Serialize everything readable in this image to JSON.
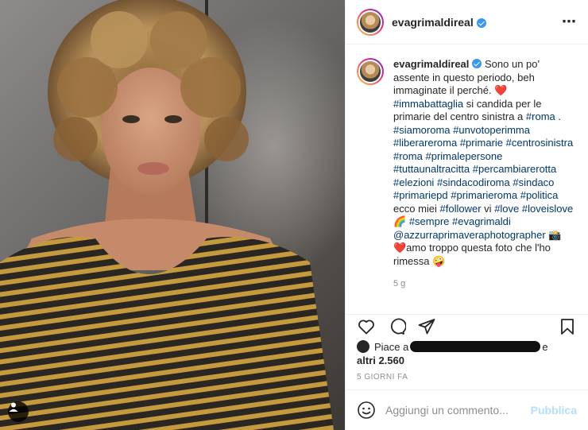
{
  "post": {
    "username": "evagrimaldireal",
    "caption": {
      "segments": [
        {
          "type": "text",
          "value": "Sono un po' assente in questo periodo, beh immaginate il perché. ❤️ "
        },
        {
          "type": "tag",
          "value": "#immabattaglia"
        },
        {
          "type": "text",
          "value": " si candida per le primarie del centro sinistra a "
        },
        {
          "type": "tag",
          "value": "#roma"
        },
        {
          "type": "text",
          "value": " . "
        },
        {
          "type": "tag",
          "value": "#siamoroma"
        },
        {
          "type": "text",
          "value": " "
        },
        {
          "type": "tag",
          "value": "#unvotoperimma"
        },
        {
          "type": "text",
          "value": " "
        },
        {
          "type": "tag",
          "value": "#liberareroma"
        },
        {
          "type": "text",
          "value": " "
        },
        {
          "type": "tag",
          "value": "#primarie"
        },
        {
          "type": "text",
          "value": " "
        },
        {
          "type": "tag",
          "value": "#centrosinistra"
        },
        {
          "type": "text",
          "value": " "
        },
        {
          "type": "tag",
          "value": "#roma"
        },
        {
          "type": "text",
          "value": " "
        },
        {
          "type": "tag",
          "value": "#primalepersone"
        },
        {
          "type": "text",
          "value": " "
        },
        {
          "type": "tag",
          "value": "#tuttaunaltracitta"
        },
        {
          "type": "text",
          "value": " "
        },
        {
          "type": "tag",
          "value": "#percambiarerotta"
        },
        {
          "type": "text",
          "value": " "
        },
        {
          "type": "tag",
          "value": "#elezioni"
        },
        {
          "type": "text",
          "value": " "
        },
        {
          "type": "tag",
          "value": "#sindacodiroma"
        },
        {
          "type": "text",
          "value": " "
        },
        {
          "type": "tag",
          "value": "#sindaco"
        },
        {
          "type": "text",
          "value": " "
        },
        {
          "type": "tag",
          "value": "#primariepd"
        },
        {
          "type": "text",
          "value": " "
        },
        {
          "type": "tag",
          "value": "#primarieroma"
        },
        {
          "type": "text",
          "value": " "
        },
        {
          "type": "tag",
          "value": "#politica"
        },
        {
          "type": "text",
          "value": " ecco miei "
        },
        {
          "type": "tag",
          "value": "#follower"
        },
        {
          "type": "text",
          "value": " vi "
        },
        {
          "type": "tag",
          "value": "#love"
        },
        {
          "type": "text",
          "value": " "
        },
        {
          "type": "tag",
          "value": "#loveislove"
        },
        {
          "type": "text",
          "value": "🌈 "
        },
        {
          "type": "tag",
          "value": "#sempre"
        },
        {
          "type": "text",
          "value": " "
        },
        {
          "type": "tag",
          "value": "#evagrimaldi"
        },
        {
          "type": "text",
          "value": " "
        },
        {
          "type": "tag",
          "value": "@azzurraprimaveraphotographer"
        },
        {
          "type": "text",
          "value": " 📸 ❤️amo troppo questa foto che l'ho rimessa 🤪"
        }
      ]
    },
    "time_ago": "5 g",
    "likes": {
      "prefix": "Piace a",
      "suffix": "e",
      "others": "altri 2.560"
    },
    "date": "5 GIORNI FA",
    "comment": {
      "placeholder": "Aggiungi un commento...",
      "publish_label": "Pubblica"
    },
    "more_icon": "⋯"
  },
  "colors": {
    "hashtag": "#00376b",
    "verified": "#3897f0",
    "publish": "#b2dffc",
    "meta": "#8e8e8e"
  },
  "icons": [
    "more-options-icon",
    "heart-icon",
    "comment-icon",
    "share-icon",
    "bookmark-icon",
    "emoji-icon",
    "user-tag-icon",
    "verified-badge-icon"
  ]
}
